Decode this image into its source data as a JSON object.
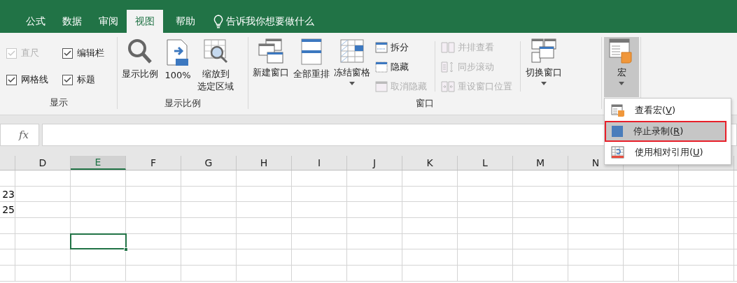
{
  "tabs": [
    {
      "label": "公式",
      "selected": false
    },
    {
      "label": "数据",
      "selected": false
    },
    {
      "label": "审阅",
      "selected": false
    },
    {
      "label": "视图",
      "selected": true
    },
    {
      "label": "帮助",
      "selected": false
    }
  ],
  "tell_me": {
    "placeholder": "告诉我你想要做什么"
  },
  "ribbon": {
    "groups": [
      {
        "label": "显示",
        "items": [
          {
            "kind": "checks",
            "checkboxes": [
              {
                "label": "直尺",
                "checked": true,
                "disabled": true
              },
              {
                "label": "编辑栏",
                "checked": true,
                "disabled": false
              },
              {
                "label": "网格线",
                "checked": true,
                "disabled": false
              },
              {
                "label": "标题",
                "checked": true,
                "disabled": false
              }
            ]
          }
        ]
      },
      {
        "label": "显示比例",
        "items": [
          {
            "kind": "large",
            "label": "显示比例",
            "dropdown": false,
            "pressed": false
          },
          {
            "kind": "large",
            "label": "100%",
            "dropdown": false,
            "pressed": false
          },
          {
            "kind": "large",
            "label": "缩放到选定区域",
            "dropdown": false,
            "pressed": false
          }
        ]
      },
      {
        "label": "窗口",
        "items": [
          {
            "kind": "large",
            "label": "新建窗口",
            "dropdown": false,
            "pressed": false
          },
          {
            "kind": "large",
            "label": "全部重排",
            "dropdown": false,
            "pressed": false
          },
          {
            "kind": "large",
            "label": "冻结窗格",
            "dropdown": true,
            "pressed": false
          },
          {
            "kind": "stack",
            "buttons": [
              {
                "label": "拆分",
                "disabled": false
              },
              {
                "label": "隐藏",
                "disabled": false
              },
              {
                "label": "取消隐藏",
                "disabled": true
              }
            ]
          },
          {
            "kind": "stack",
            "buttons": [
              {
                "label": "并排查看",
                "disabled": true
              },
              {
                "label": "同步滚动",
                "disabled": true
              },
              {
                "label": "重设窗口位置",
                "disabled": true
              }
            ]
          },
          {
            "kind": "large",
            "label": "切换窗口",
            "dropdown": true,
            "pressed": false
          }
        ]
      },
      {
        "items": [
          {
            "kind": "large",
            "label": "宏",
            "dropdown": true,
            "pressed": true
          }
        ]
      }
    ]
  },
  "formula_bar": {
    "fx": "fx"
  },
  "sheet": {
    "columns": [
      {
        "selected": false
      },
      {
        "label": "D",
        "selected": false
      },
      {
        "label": "E",
        "selected": true
      },
      {
        "label": "F",
        "selected": false
      },
      {
        "label": "G",
        "selected": false
      },
      {
        "label": "H",
        "selected": false
      },
      {
        "label": "I",
        "selected": false
      },
      {
        "label": "J",
        "selected": false
      },
      {
        "label": "K",
        "selected": false
      },
      {
        "label": "L",
        "selected": false
      },
      {
        "label": "M",
        "selected": false
      },
      {
        "label": "N",
        "selected": false
      },
      {
        "selected": false
      },
      {
        "selected": false
      }
    ],
    "rows": [
      {
        "selected": false
      },
      {
        "partial_cell": "23",
        "selected": false
      },
      {
        "partial_cell": "25",
        "selected": false
      },
      {
        "selected": false
      },
      {
        "selected": true
      },
      {
        "selected": false
      },
      {
        "selected": false
      }
    ]
  },
  "macro_menu": {
    "items": [
      {
        "label": "查看宏(",
        "accesskey": "V",
        "close": ")",
        "selected": false,
        "outlined": false
      },
      {
        "label": "停止录制(",
        "accesskey": "R",
        "close": ")",
        "selected": true,
        "outlined": true
      },
      {
        "label": "使用相对引用(",
        "accesskey": "U",
        "close": ")",
        "selected": false,
        "outlined": false
      }
    ]
  }
}
